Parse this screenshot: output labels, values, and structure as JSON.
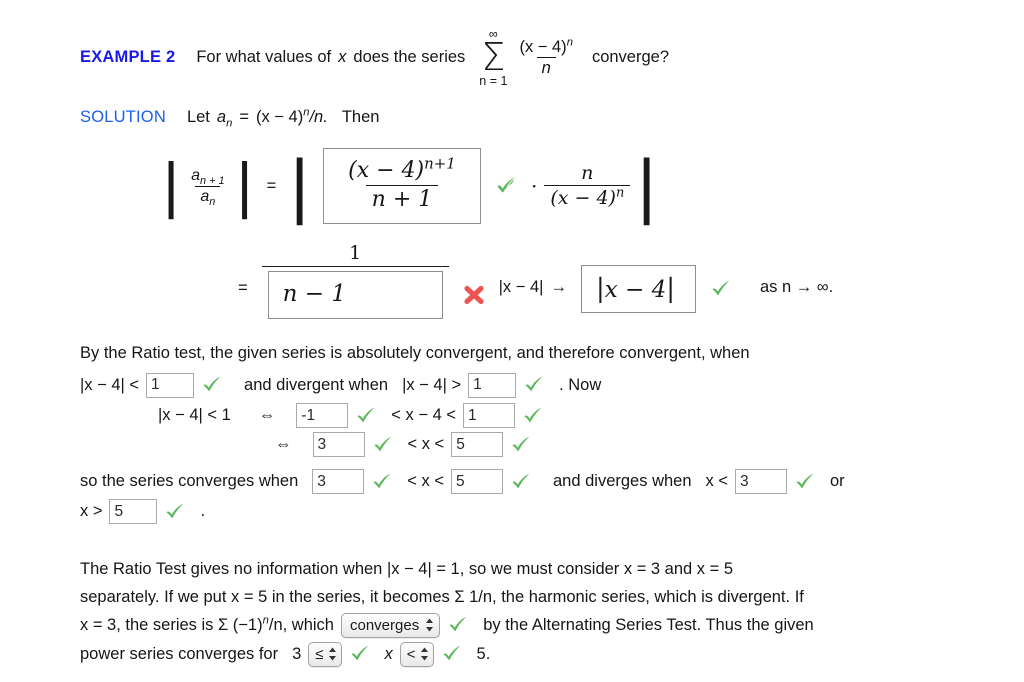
{
  "document": {
    "example_label": "EXAMPLE 2",
    "solution_label": "SOLUTION",
    "colors": {
      "heading_blue": "#1a1ae8",
      "solution_blue": "#1a5ff0",
      "check_green": "#5cb85c",
      "cross_red": "#ef5350"
    }
  },
  "problem": {
    "prompt_before": "For what values of",
    "prompt_var": "x",
    "prompt_after": "does the series",
    "sum_upper": "∞",
    "sum_lower": "n = 1",
    "sum_numerator": "(x − 4)",
    "sum_numerator_exp": "n",
    "sum_denominator": "n",
    "prompt_end": "converge?"
  },
  "solution_intro": {
    "let_text": "Let",
    "a_symbol": "a",
    "a_subscript": "n",
    "equals": "=",
    "expression": "(x − 4)",
    "expression_exp": "n",
    "expression_tail": "/n.",
    "then_text": "Then"
  },
  "equation_row_1": {
    "lhs_num": "a",
    "lhs_num_sub": "n + 1",
    "lhs_den": "a",
    "lhs_den_sub": "n",
    "equals": "=",
    "answer_box": {
      "numerator": "(x − 4)",
      "numerator_exp": "n+1",
      "denominator": "n + 1",
      "status": "correct"
    },
    "dot": "·",
    "rhs_num": "n",
    "rhs_den": "(x − 4)",
    "rhs_den_exp": "n"
  },
  "equation_row_2": {
    "equals": "=",
    "fraction_numerator": "1",
    "answer_box_den": {
      "value": "n − 1",
      "status": "incorrect"
    },
    "mid_text": "|x − 4|",
    "arrow": "→",
    "answer_box_limit": {
      "value": "x − 4",
      "status": "correct"
    },
    "trailing_text": "as n → ∞."
  },
  "ratio_paragraph": {
    "line1": "By the Ratio test, the given series is absolutely convergent, and therefore convergent, when",
    "line2_prefix": "|x − 4| <",
    "input_less": {
      "value": "1",
      "status": "correct"
    },
    "line2_middle": "and divergent when",
    "line2_expr": "|x − 4| >",
    "input_greater": {
      "value": "1",
      "status": "correct"
    },
    "line2_suffix": ". Now"
  },
  "inequalities": {
    "row1": {
      "lhs": "|x − 4| < 1",
      "iff": "⇔",
      "left_input": {
        "value": "-1",
        "status": "correct"
      },
      "middle": "< x − 4 <",
      "right_input": {
        "value": "1",
        "status": "correct"
      }
    },
    "row2": {
      "iff": "⇔",
      "left_input": {
        "value": "3",
        "status": "correct"
      },
      "middle": "< x <",
      "right_input": {
        "value": "5",
        "status": "correct"
      }
    }
  },
  "convergence_line": {
    "prefix": "so the series converges when",
    "input_low": {
      "value": "3",
      "status": "correct"
    },
    "middle": "< x <",
    "input_high": {
      "value": "5",
      "status": "correct"
    },
    "diverges_text": "and diverges when",
    "diverges_expr": "x <",
    "input_div_low": {
      "value": "3",
      "status": "correct"
    },
    "or_text": "or",
    "second_line_expr": "x >",
    "input_div_high": {
      "value": "5",
      "status": "correct"
    },
    "second_line_suffix": "."
  },
  "final_paragraph": {
    "line1": "The Ratio Test gives no information when  |x − 4| = 1,  so we must consider  x = 3  and  x = 5",
    "line2": "separately. If we put  x = 5  in the series, it becomes  Σ 1/n,  the harmonic series, which is divergent. If",
    "line3_prefix": "x = 3,  the series is  Σ (−1)",
    "line3_exp": "n",
    "line3_mid": "/n,  which",
    "select_converges": {
      "value": "converges",
      "status": "correct"
    },
    "line3_suffix": "by the Alternating Series Test. Thus the given",
    "line4_prefix": "power series converges for",
    "bound_low": "3",
    "select_op_left": {
      "value": "≤",
      "status": "correct"
    },
    "variable": "x",
    "select_op_right": {
      "value": "<",
      "status": "correct"
    },
    "bound_high": "5."
  }
}
